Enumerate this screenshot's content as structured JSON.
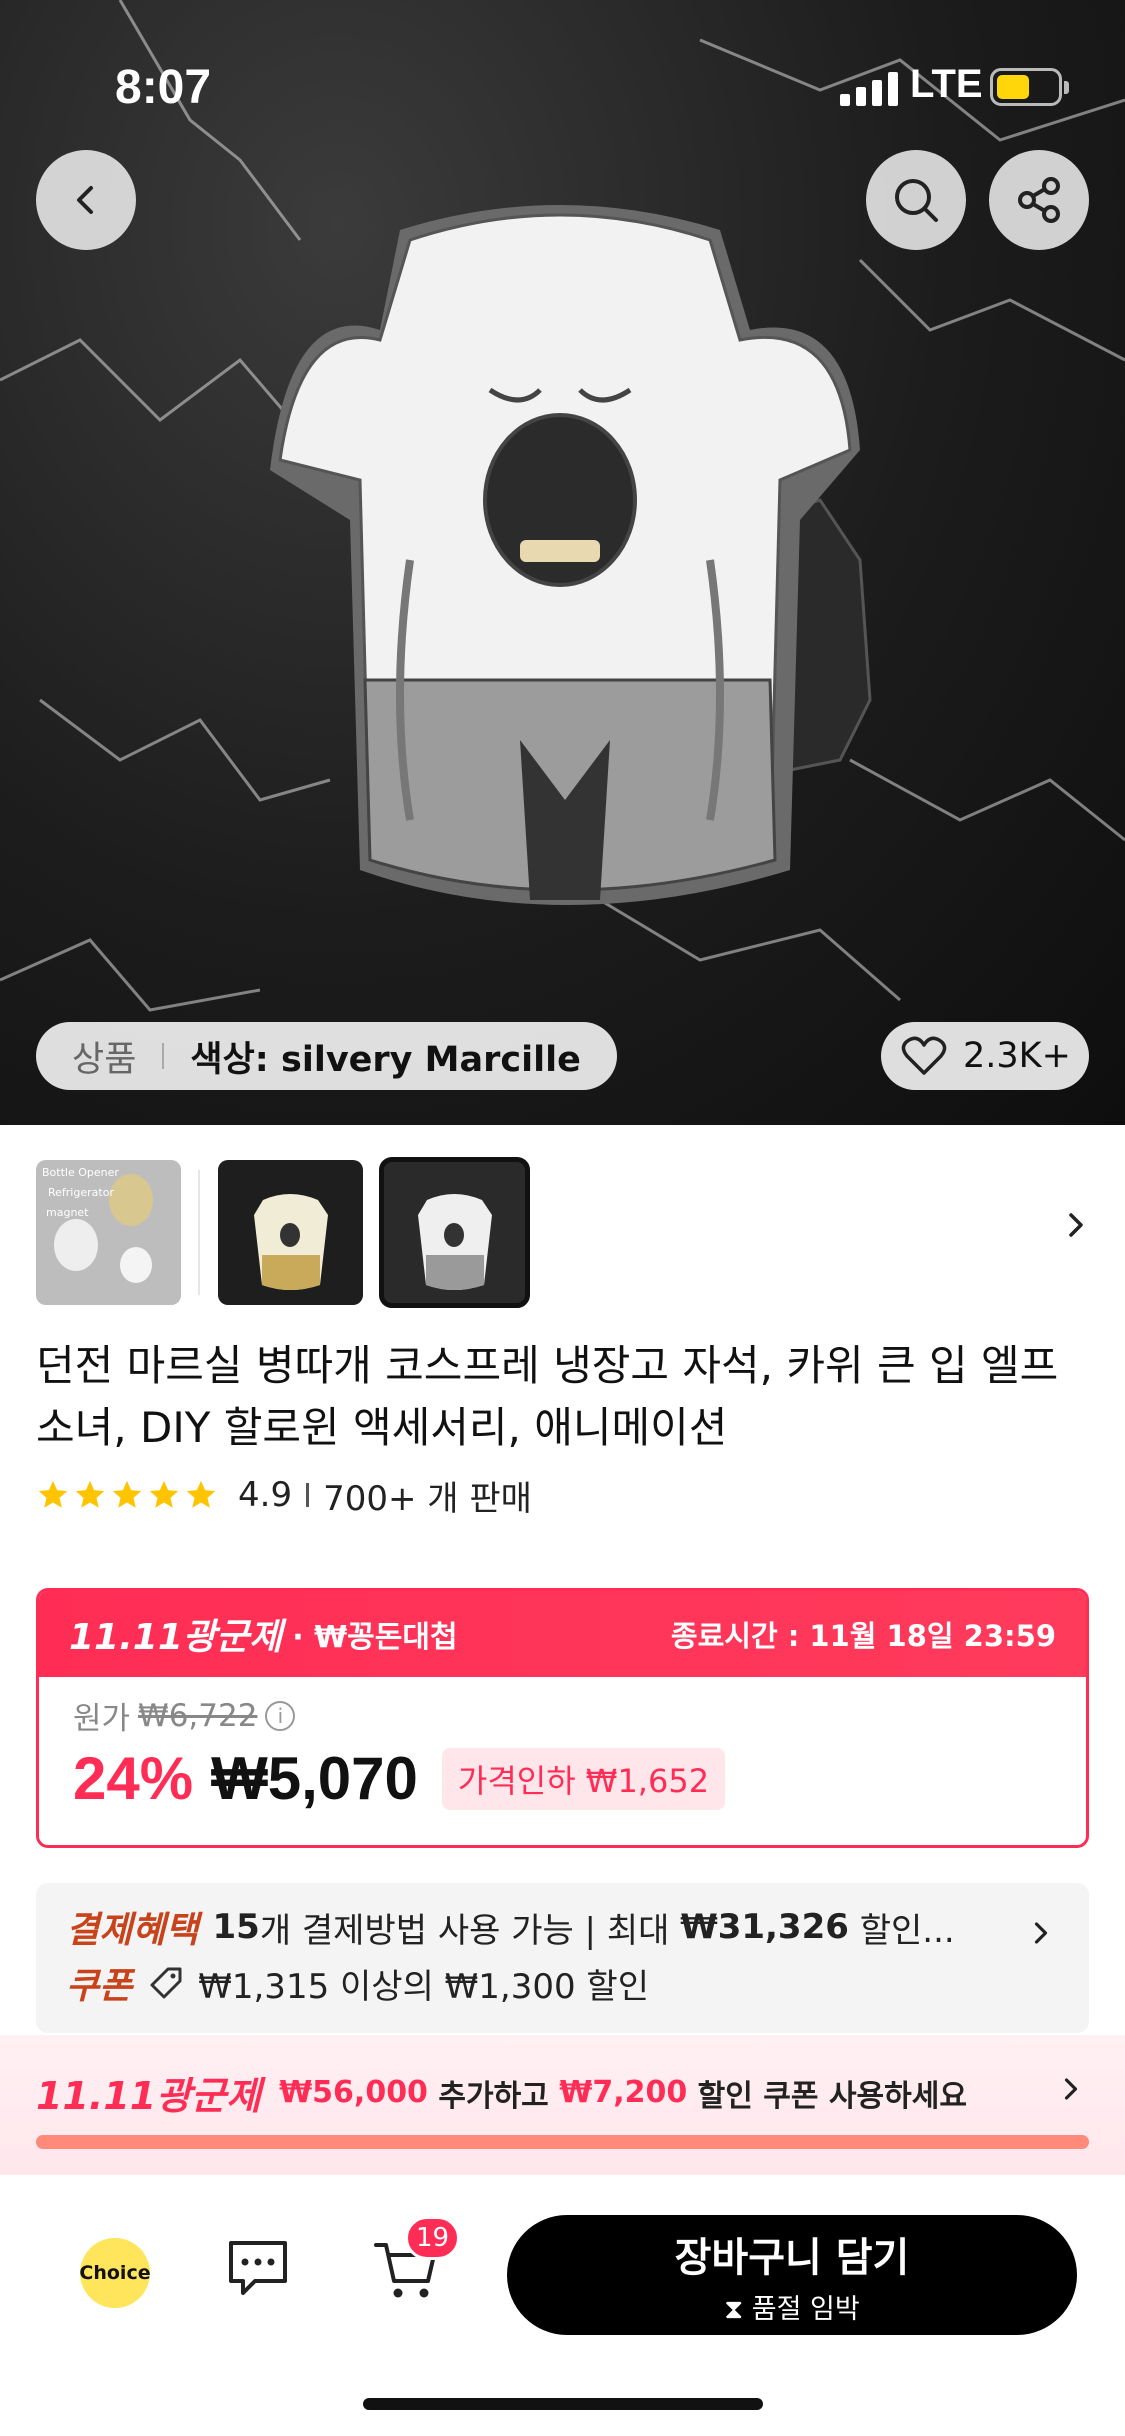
{
  "status_bar": {
    "time": "8:07",
    "network": "LTE"
  },
  "hero": {
    "variant_label": "상품",
    "variant_value": "색상: silvery Marcille",
    "likes": "2.3K+",
    "image_description_icon": "elf-bottle-opener-magnet"
  },
  "thumbnails": [
    {
      "name": "thumb-bottle-opener-set",
      "lines": [
        "Bottle Opener",
        "Refrigerator",
        "magnet"
      ],
      "selected": false
    },
    {
      "name": "thumb-gold-marcille",
      "selected": false
    },
    {
      "name": "thumb-silvery-marcille",
      "selected": true
    }
  ],
  "product": {
    "title": "던전 마르실 병따개 코스프레 냉장고 자석, 카위 큰 입 엘프 소녀, DIY 할로윈 액세서리, 애니메이션",
    "rating": "4.9",
    "stars": 5,
    "sold": "700+ 개 판매"
  },
  "promo": {
    "event": "11.11광군제",
    "sub": "· ₩꽁돈대첩",
    "ends": "종료시간 : 11월 18일 23:59",
    "orig_label": "원가",
    "orig_price": "₩6,722",
    "discount": "24%",
    "price": "₩5,070",
    "drop": "가격인하 ₩1,652"
  },
  "benefits": {
    "payment_label": "결제혜택",
    "payment_count": "15",
    "payment_text": "개 결제방법 사용 가능 | 최대 ",
    "payment_max": "₩31,326",
    "payment_tail": " 할인...",
    "coupon_label": "쿠폰",
    "coupon_text": "₩1,315 이상의 ₩1,300 할인"
  },
  "strip": {
    "event": "11.11광군제",
    "amount1": "₩56,000",
    "text1": " 추가하고 ",
    "amount2": "₩7,200",
    "text2": " 할인 쿠폰 사용하세요",
    "progress": 1.0
  },
  "bottom_bar": {
    "choice_label": "Choice",
    "cart_count": "19",
    "buy_label": "장바구니 담기",
    "buy_sub": "품절 임박"
  },
  "colors": {
    "accent": "#ff2d55",
    "coupon_label": "#c8421a",
    "battery": "#ffd60a"
  }
}
